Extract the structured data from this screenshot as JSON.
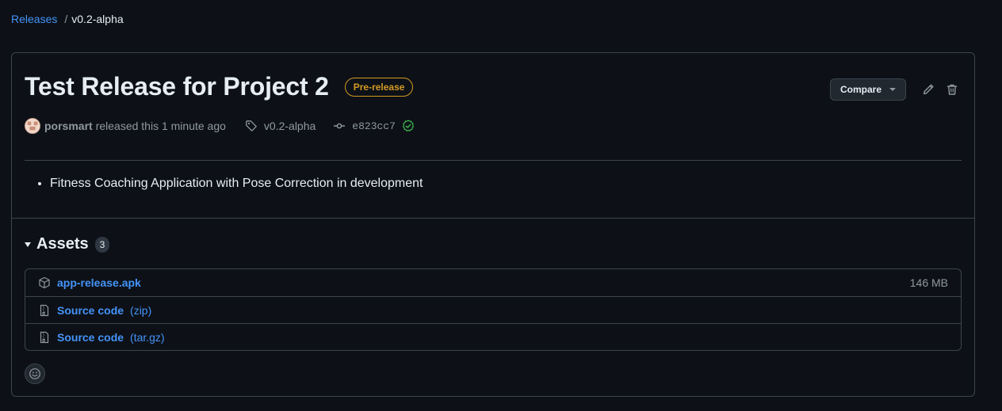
{
  "breadcrumb": {
    "parent": "Releases",
    "separator": "/",
    "current": "v0.2-alpha"
  },
  "release": {
    "title": "Test Release for Project 2",
    "badge": "Pre-release",
    "author": "porsmart",
    "released_text": "released this 1 minute ago",
    "tag": "v0.2-alpha",
    "commit": "e823cc7",
    "notes": [
      "Fitness Coaching Application with Pose Correction in development"
    ]
  },
  "actions": {
    "compare_label": "Compare"
  },
  "assets": {
    "title": "Assets",
    "count": "3",
    "items": [
      {
        "name": "app-release.apk",
        "ext": "",
        "size": "146 MB",
        "icon": "package-icon"
      },
      {
        "name": "Source code",
        "ext": "(zip)",
        "size": "",
        "icon": "file-zip-icon"
      },
      {
        "name": "Source code",
        "ext": "(tar.gz)",
        "size": "",
        "icon": "file-zip-icon"
      }
    ]
  },
  "colors": {
    "background": "#0d1117",
    "link": "#4493f8",
    "prerelease": "#d29922",
    "verified": "#3fb950",
    "border": "#3d444d"
  }
}
